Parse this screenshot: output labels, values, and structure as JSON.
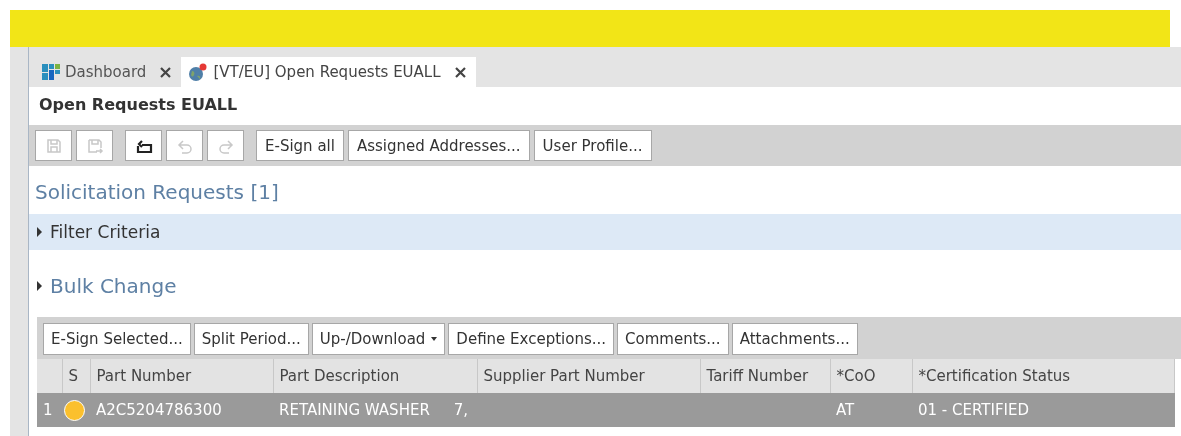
{
  "tabs": [
    {
      "label": "Dashboard",
      "kind": "dashboard",
      "selected": false
    },
    {
      "label": "[VT/EU] Open Requests EUALL",
      "kind": "globe",
      "selected": true
    }
  ],
  "page_title": "Open Requests EUALL",
  "toolbar": {
    "icon_buttons": [
      {
        "kind": "save",
        "disabled": true
      },
      {
        "kind": "save-next",
        "disabled": true
      },
      {
        "kind": "reset",
        "disabled": false
      },
      {
        "kind": "undo",
        "disabled": true
      },
      {
        "kind": "redo",
        "disabled": true
      }
    ],
    "buttons": [
      "E-Sign all",
      "Assigned Addresses...",
      "User Profile..."
    ]
  },
  "section_title": "Solicitation Requests [1]",
  "filter": {
    "label": "Filter Criteria",
    "expanded": false
  },
  "bulk_change": {
    "label": "Bulk Change",
    "expanded": false
  },
  "grid_buttons": [
    {
      "label": "E-Sign Selected...",
      "kind": "plain"
    },
    {
      "label": "Split Period...",
      "kind": "plain"
    },
    {
      "label": "Up-/Download",
      "kind": "dropdown"
    },
    {
      "label": "Define Exceptions...",
      "kind": "plain"
    },
    {
      "label": "Comments...",
      "kind": "plain"
    },
    {
      "label": "Attachments...",
      "kind": "plain"
    }
  ],
  "table": {
    "columns": [
      "",
      "S",
      "Part Number",
      "Part Description",
      "Supplier Part Number",
      "Tariff Number",
      "*CoO",
      "*Certification Status"
    ],
    "rows": [
      {
        "selected": true,
        "color": "#fbc02d",
        "cells": [
          "1",
          "",
          "A2C5204786300",
          "RETAINING WASHER     7,",
          "",
          "",
          "AT",
          "01 - CERTIFIED"
        ]
      }
    ]
  }
}
